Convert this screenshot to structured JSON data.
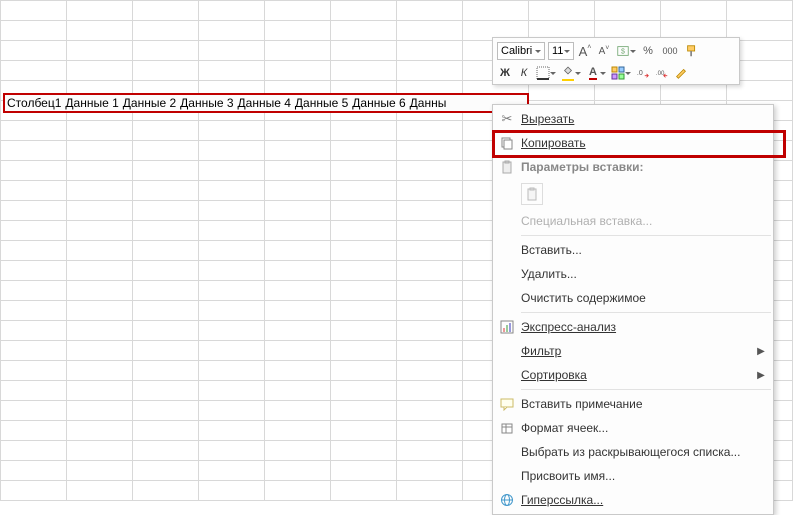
{
  "selection": {
    "cells": [
      "Столбец1",
      "Данные 1",
      "Данные 2",
      "Данные 3",
      "Данные 4",
      "Данные 5",
      "Данные 6",
      "Данны"
    ]
  },
  "mini_toolbar": {
    "font": "Calibri",
    "size": "11",
    "grow": "A",
    "shrink": "A",
    "percent": "%",
    "thousands": "000",
    "bold": "Ж",
    "italic": "К",
    "font_color_glyph": "А"
  },
  "context_menu": {
    "cut": "Вырезать",
    "copy": "Копировать",
    "paste_options": "Параметры вставки:",
    "paste_special": "Специальная вставка...",
    "insert": "Вставить...",
    "delete": "Удалить...",
    "clear": "Очистить содержимое",
    "quick_analysis": "Экспресс-анализ",
    "filter": "Фильтр",
    "sort": "Сортировка",
    "insert_comment": "Вставить примечание",
    "format_cells": "Формат ячеек...",
    "dropdown_list": "Выбрать из раскрывающегося списка...",
    "define_name": "Присвоить имя...",
    "hyperlink": "Гиперссылка..."
  }
}
